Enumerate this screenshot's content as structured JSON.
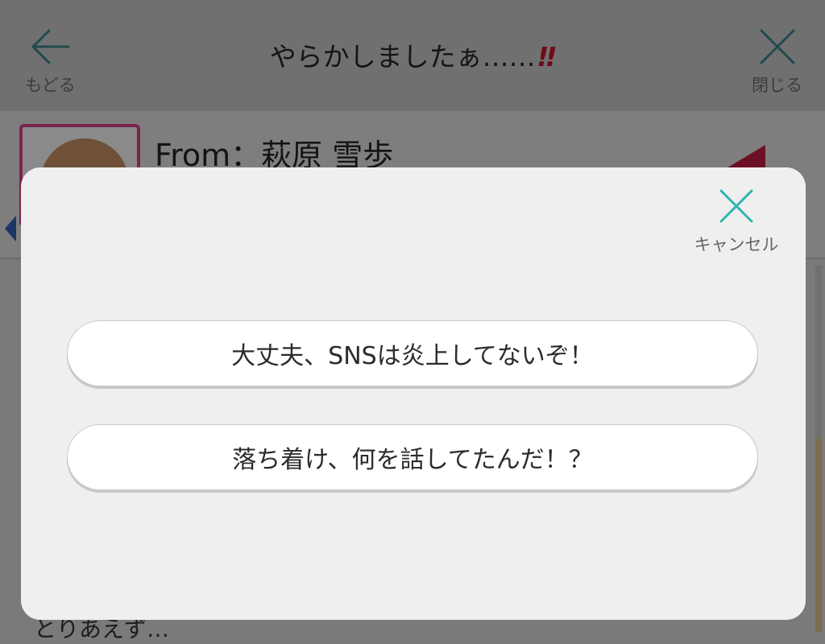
{
  "header": {
    "back_label": "もどる",
    "title": "やらかしましたぁ……",
    "title_mark": "‼",
    "close_label": "閉じる"
  },
  "sender": {
    "from_text": "From：萩原 雪歩"
  },
  "background_peek_text": "とりあえず…",
  "modal": {
    "cancel_label": "キャンセル",
    "choices": [
      {
        "label": "大丈夫、SNSは炎上してないぞ！"
      },
      {
        "label": "落ち着け、何を話してたんだ！？"
      }
    ]
  },
  "colors": {
    "accent_teal": "#2fb5b0",
    "header_icon_teal": "#1f4a4e",
    "title_mark_red": "#6e0a14"
  },
  "icons": [
    "back-arrow-icon",
    "close-x-icon",
    "cancel-x-icon"
  ]
}
